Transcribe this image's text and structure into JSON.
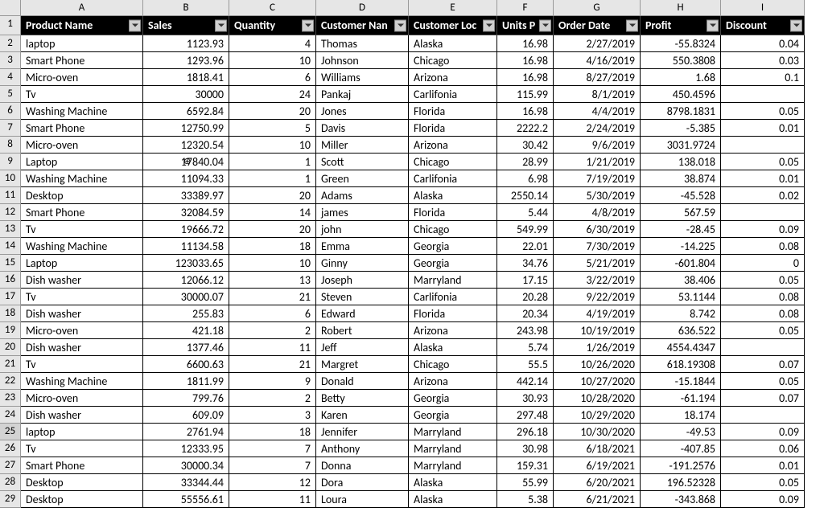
{
  "columns": [
    "A",
    "B",
    "C",
    "D",
    "E",
    "F",
    "G",
    "H",
    "I"
  ],
  "headers": [
    "Product Name",
    "Sales",
    "Quantity",
    "Customer Name",
    "Customer Location",
    "Units Price",
    "Order Date",
    "Profit",
    "Discount"
  ],
  "headersDisplay": [
    "Product Name",
    "Sales",
    "Quantity",
    "Customer Nan",
    "Customer Loc",
    "Units P",
    "Order Date",
    "Profit",
    "Discount"
  ],
  "rowNumbers": [
    1,
    2,
    3,
    4,
    5,
    6,
    7,
    8,
    9,
    10,
    11,
    12,
    13,
    14,
    15,
    16,
    17,
    18,
    19,
    20,
    21,
    22,
    23,
    24,
    25,
    26,
    27,
    28,
    29
  ],
  "selectedRow": 25,
  "cursorCell": {
    "row": 9,
    "col": "B"
  },
  "rows": [
    {
      "product": "laptop",
      "sales": "1123.93",
      "qty": "4",
      "cust": "Thomas",
      "loc": "Alaska",
      "unit": "16.98",
      "date": "2/27/2019",
      "profit": "-55.8324",
      "disc": "0.04"
    },
    {
      "product": "Smart Phone",
      "sales": "1293.96",
      "qty": "10",
      "cust": "Johnson",
      "loc": "Chicago",
      "unit": "16.98",
      "date": "4/16/2019",
      "profit": "550.3808",
      "disc": "0.03"
    },
    {
      "product": "Micro-oven",
      "sales": "1818.41",
      "qty": "6",
      "cust": "Williams",
      "loc": "Arizona",
      "unit": "16.98",
      "date": "8/27/2019",
      "profit": "1.68",
      "disc": "0.1"
    },
    {
      "product": "Tv",
      "sales": "30000",
      "qty": "24",
      "cust": "Pankaj",
      "loc": "Carlifonia",
      "unit": "115.99",
      "date": "8/1/2019",
      "profit": "450.4596",
      "disc": ""
    },
    {
      "product": "Washing Machine",
      "sales": "6592.84",
      "qty": "20",
      "cust": "Jones",
      "loc": "Florida",
      "unit": "16.98",
      "date": "4/4/2019",
      "profit": "8798.1831",
      "disc": "0.05"
    },
    {
      "product": "Smart Phone",
      "sales": "12750.99",
      "qty": "5",
      "cust": "Davis",
      "loc": "Florida",
      "unit": "2222.2",
      "date": "2/24/2019",
      "profit": "-5.385",
      "disc": "0.01"
    },
    {
      "product": "Micro-oven",
      "sales": "12320.54",
      "qty": "10",
      "cust": "Miller",
      "loc": "Arizona",
      "unit": "30.42",
      "date": "9/6/2019",
      "profit": "3031.9724",
      "disc": ""
    },
    {
      "product": "Laptop",
      "sales": "17840.04",
      "qty": "1",
      "cust": "Scott",
      "loc": "Chicago",
      "unit": "28.99",
      "date": "1/21/2019",
      "profit": "138.018",
      "disc": "0.05"
    },
    {
      "product": "Washing Machine",
      "sales": "11094.33",
      "qty": "1",
      "cust": "Green",
      "loc": "Carlifonia",
      "unit": "6.98",
      "date": "7/19/2019",
      "profit": "38.874",
      "disc": "0.01"
    },
    {
      "product": "Desktop",
      "sales": "33389.97",
      "qty": "20",
      "cust": "Adams",
      "loc": "Alaska",
      "unit": "2550.14",
      "date": "5/30/2019",
      "profit": "-45.528",
      "disc": "0.02"
    },
    {
      "product": "Smart Phone",
      "sales": "32084.59",
      "qty": "14",
      "cust": "james",
      "loc": "Florida",
      "unit": "5.44",
      "date": "4/8/2019",
      "profit": "567.59",
      "disc": ""
    },
    {
      "product": "Tv",
      "sales": "19666.72",
      "qty": "20",
      "cust": "john",
      "loc": "Chicago",
      "unit": "549.99",
      "date": "6/30/2019",
      "profit": "-28.45",
      "disc": "0.09"
    },
    {
      "product": "Washing Machine",
      "sales": "11134.58",
      "qty": "18",
      "cust": "Emma",
      "loc": "Georgia",
      "unit": "22.01",
      "date": "7/30/2019",
      "profit": "-14.225",
      "disc": "0.08"
    },
    {
      "product": "Laptop",
      "sales": "123033.65",
      "qty": "10",
      "cust": "Ginny",
      "loc": "Georgia",
      "unit": "34.76",
      "date": "5/21/2019",
      "profit": "-601.804",
      "disc": "0"
    },
    {
      "product": "Dish washer",
      "sales": "12066.12",
      "qty": "13",
      "cust": "Joseph",
      "loc": "Marryland",
      "unit": "17.15",
      "date": "3/22/2019",
      "profit": "38.406",
      "disc": "0.05"
    },
    {
      "product": "Tv",
      "sales": "30000.07",
      "qty": "21",
      "cust": "Steven",
      "loc": "Carlifonia",
      "unit": "20.28",
      "date": "9/22/2019",
      "profit": "53.1144",
      "disc": "0.08"
    },
    {
      "product": "Dish washer",
      "sales": "255.83",
      "qty": "6",
      "cust": "Edward",
      "loc": "Florida",
      "unit": "20.34",
      "date": "4/19/2019",
      "profit": "8.742",
      "disc": "0.08"
    },
    {
      "product": "Micro-oven",
      "sales": "421.18",
      "qty": "2",
      "cust": "Robert",
      "loc": "Arizona",
      "unit": "243.98",
      "date": "10/19/2019",
      "profit": "636.522",
      "disc": "0.05"
    },
    {
      "product": "Dish washer",
      "sales": "1377.46",
      "qty": "11",
      "cust": "Jeff",
      "loc": "Alaska",
      "unit": "5.74",
      "date": "1/26/2019",
      "profit": "4554.4347",
      "disc": ""
    },
    {
      "product": "Tv",
      "sales": "6600.63",
      "qty": "21",
      "cust": "Margret",
      "loc": "Chicago",
      "unit": "55.5",
      "date": "10/26/2020",
      "profit": "618.19308",
      "disc": "0.07"
    },
    {
      "product": "Washing Machine",
      "sales": "1811.99",
      "qty": "9",
      "cust": "Donald",
      "loc": "Arizona",
      "unit": "442.14",
      "date": "10/27/2020",
      "profit": "-15.1844",
      "disc": "0.05"
    },
    {
      "product": "Micro-oven",
      "sales": "799.76",
      "qty": "2",
      "cust": "Betty",
      "loc": "Georgia",
      "unit": "30.93",
      "date": "10/28/2020",
      "profit": "-61.194",
      "disc": "0.07"
    },
    {
      "product": "Dish washer",
      "sales": "609.09",
      "qty": "3",
      "cust": "Karen",
      "loc": "Georgia",
      "unit": "297.48",
      "date": "10/29/2020",
      "profit": "18.174",
      "disc": ""
    },
    {
      "product": "laptop",
      "sales": "2761.94",
      "qty": "18",
      "cust": "Jennifer",
      "loc": "Marryland",
      "unit": "296.18",
      "date": "10/30/2020",
      "profit": "-49.53",
      "disc": "0.09"
    },
    {
      "product": "Tv",
      "sales": "12333.95",
      "qty": "7",
      "cust": "Anthony",
      "loc": "Marryland",
      "unit": "30.98",
      "date": "6/18/2021",
      "profit": "-407.85",
      "disc": "0.06"
    },
    {
      "product": "Smart Phone",
      "sales": "30000.34",
      "qty": "7",
      "cust": "Donna",
      "loc": "Marryland",
      "unit": "159.31",
      "date": "6/19/2021",
      "profit": "-191.2576",
      "disc": "0.01"
    },
    {
      "product": "Desktop",
      "sales": "33344.44",
      "qty": "12",
      "cust": "Dora",
      "loc": "Alaska",
      "unit": "55.99",
      "date": "6/20/2021",
      "profit": "196.52328",
      "disc": "0.05"
    },
    {
      "product": "Desktop",
      "sales": "55556.61",
      "qty": "11",
      "cust": "Loura",
      "loc": "Alaska",
      "unit": "5.38",
      "date": "6/21/2021",
      "profit": "-343.868",
      "disc": "0.09"
    }
  ]
}
